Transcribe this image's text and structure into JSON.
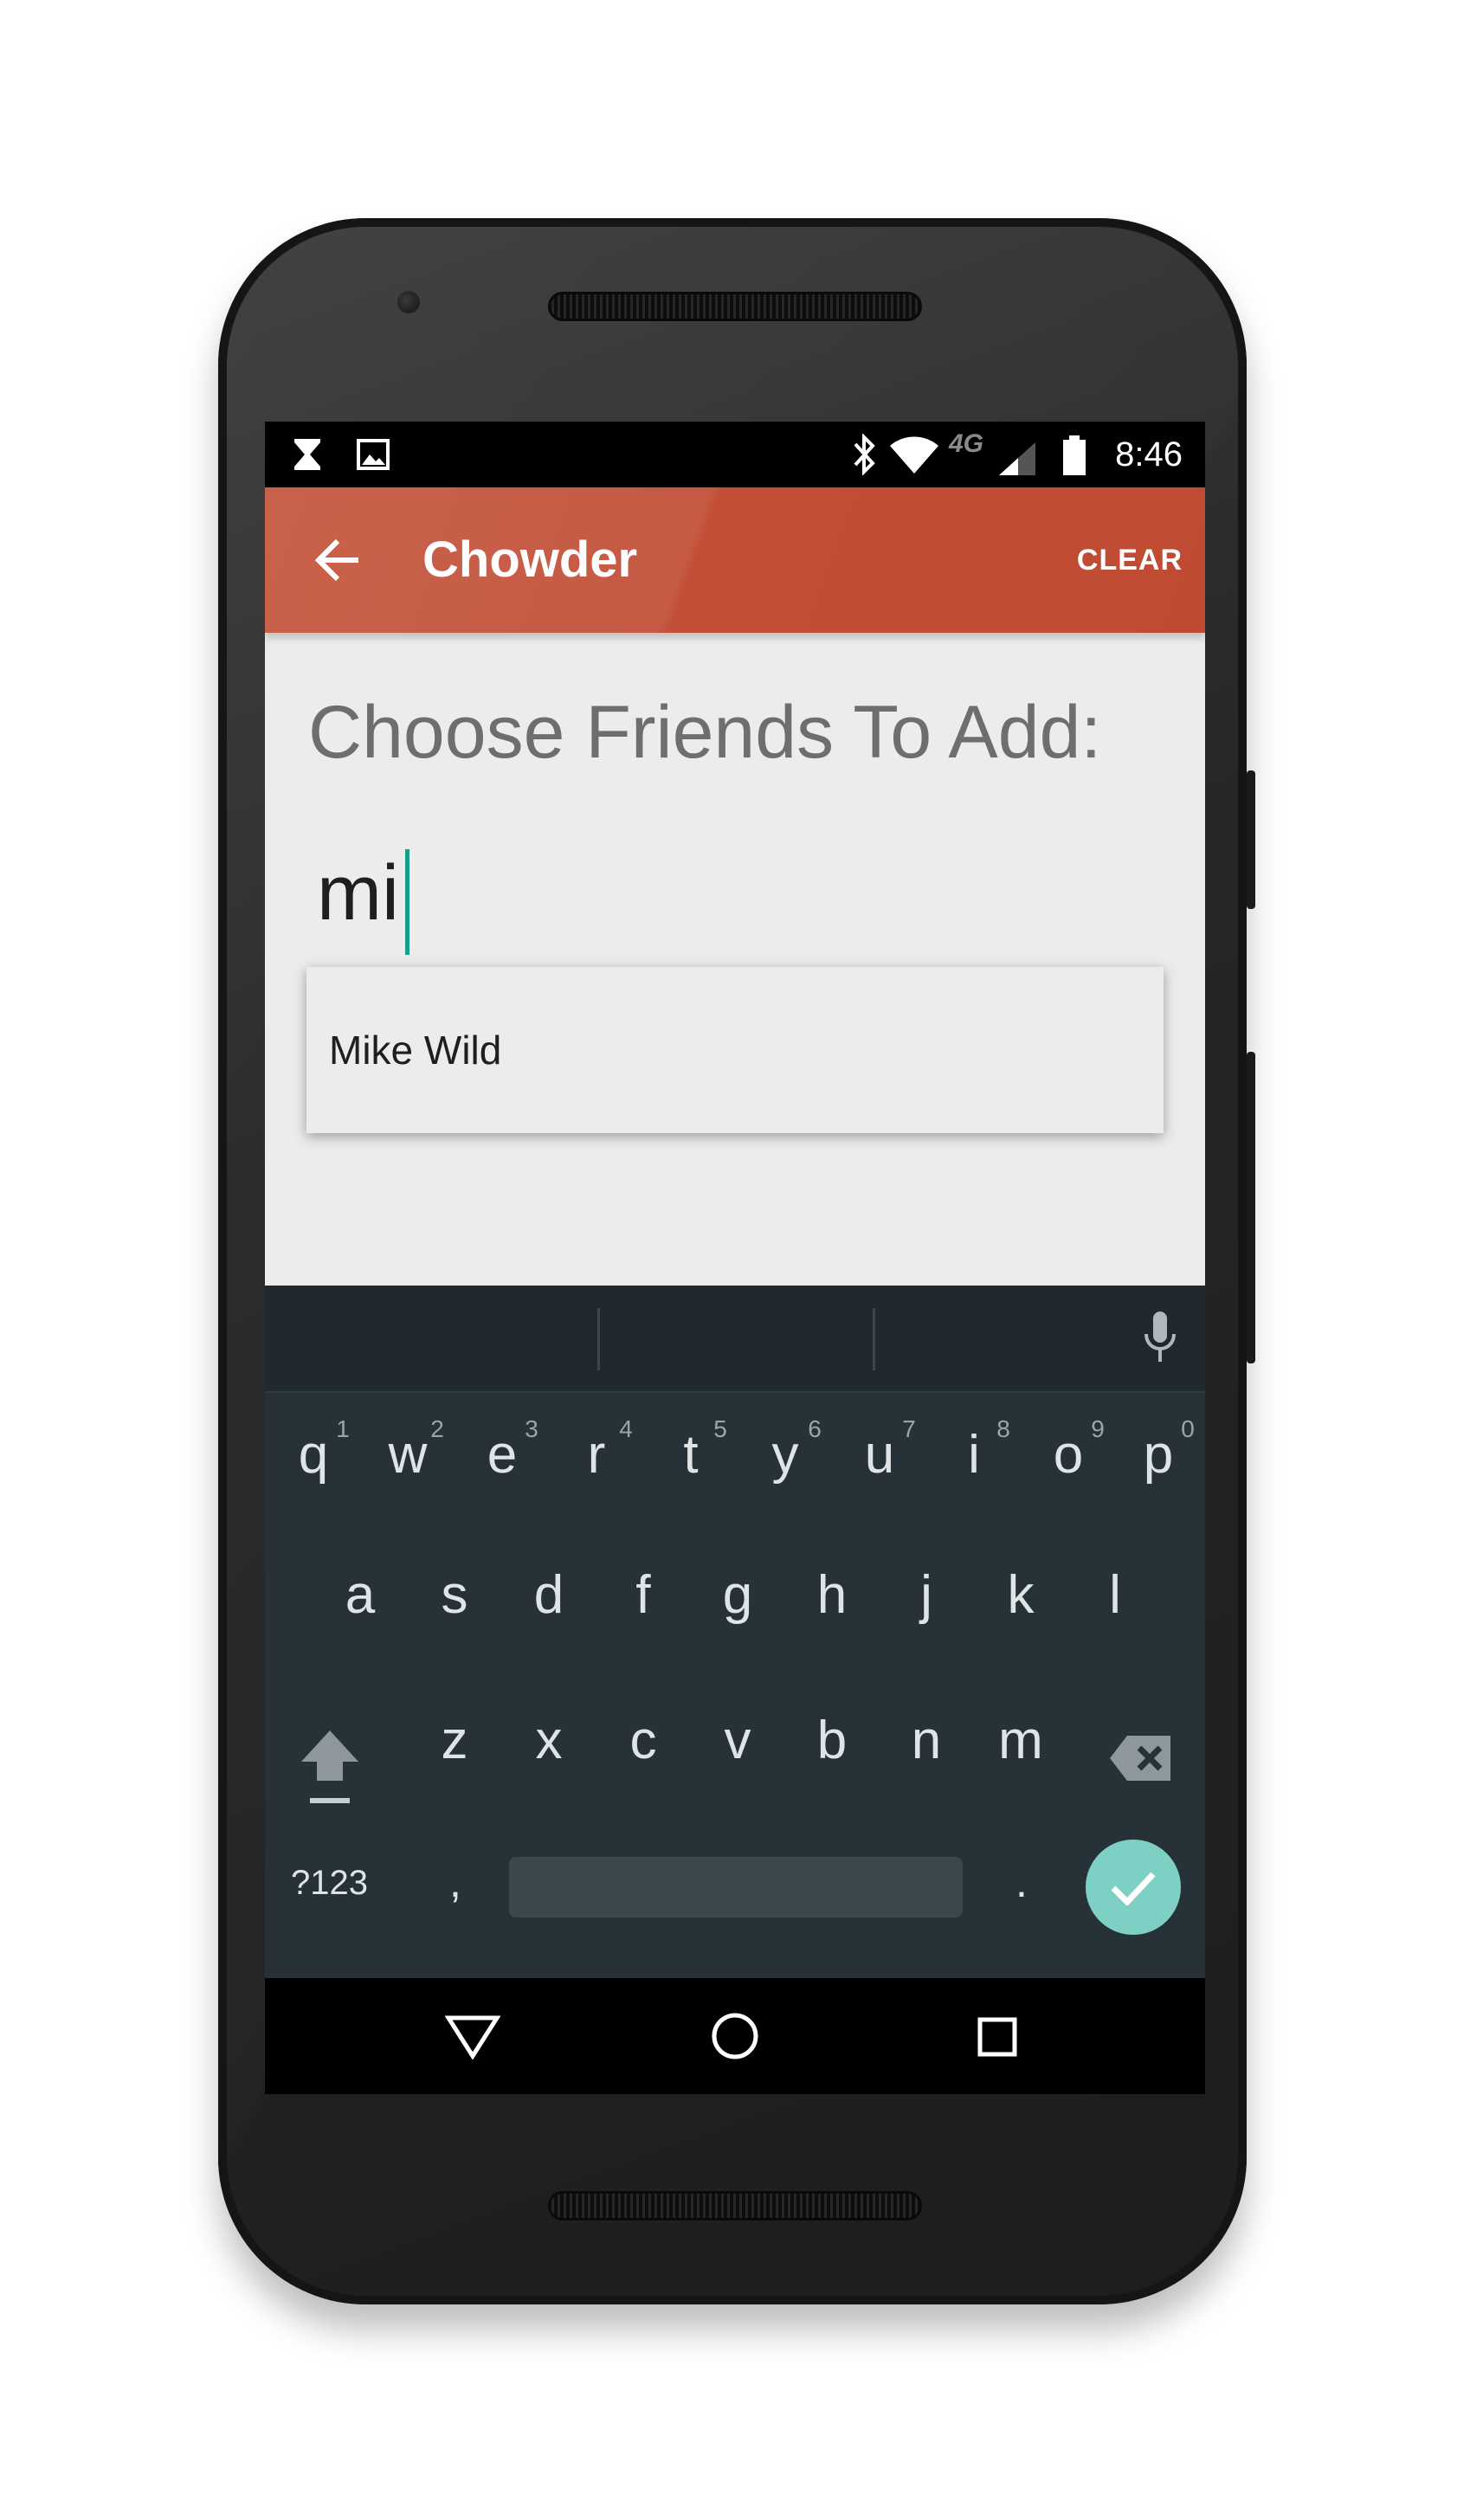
{
  "status_bar": {
    "time": "8:46",
    "network_label": "4G",
    "left_icons": [
      "hourglass-icon",
      "image-icon"
    ],
    "right_icons": [
      "bluetooth-icon",
      "wifi-icon",
      "signal-icon",
      "battery-icon"
    ]
  },
  "app_bar": {
    "title": "Chowder",
    "action_label": "CLEAR"
  },
  "content": {
    "heading": "Choose Friends To Add:",
    "search": {
      "value": "mi"
    },
    "suggestions": [
      {
        "label": "Mike Wild"
      }
    ]
  },
  "keyboard": {
    "row1": [
      {
        "key": "q",
        "hint": "1"
      },
      {
        "key": "w",
        "hint": "2"
      },
      {
        "key": "e",
        "hint": "3"
      },
      {
        "key": "r",
        "hint": "4"
      },
      {
        "key": "t",
        "hint": "5"
      },
      {
        "key": "y",
        "hint": "6"
      },
      {
        "key": "u",
        "hint": "7"
      },
      {
        "key": "i",
        "hint": "8"
      },
      {
        "key": "o",
        "hint": "9"
      },
      {
        "key": "p",
        "hint": "0"
      }
    ],
    "row2": [
      "a",
      "s",
      "d",
      "f",
      "g",
      "h",
      "j",
      "k",
      "l"
    ],
    "row3": [
      "z",
      "x",
      "c",
      "v",
      "b",
      "n",
      "m"
    ],
    "symbols_label": "?123",
    "comma_label": ",",
    "period_label": ".",
    "colors": {
      "background": "#263238",
      "enter_key": "#7ecfc4"
    }
  },
  "nav_bar": {
    "icons": [
      "back-triangle-icon",
      "home-circle-icon",
      "recents-square-icon"
    ]
  },
  "colors": {
    "app_bar": "#c65a44",
    "cursor": "#199e8c",
    "screen_background": "#ececec"
  }
}
